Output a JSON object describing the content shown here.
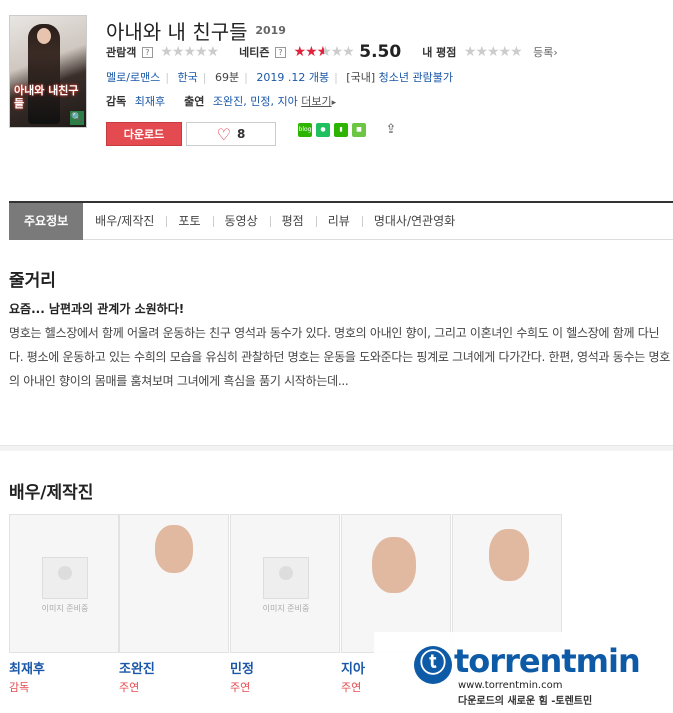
{
  "movie": {
    "title": "아내와 내 친구들",
    "year": "2019",
    "poster_title": "아내와 내친구들"
  },
  "ratings": {
    "audience_label": "관람객",
    "audience_stars": "★★★★★",
    "netizen_label": "네티즌",
    "netizen_score": "5.50",
    "netizen_stars_on": 2.5,
    "my_label": "내 평점",
    "register_label": "등록›"
  },
  "meta": {
    "genre": "멜로/로맨스",
    "country": "한국",
    "runtime": "69분",
    "release": "2019 .12 개봉",
    "rating_prefix": "[국내]",
    "rating": "청소년 관람불가"
  },
  "people": {
    "director_label": "감독",
    "director": "최재후",
    "cast_label": "출연",
    "cast": "조완진, 민정, 지아",
    "more": "더보기"
  },
  "actions": {
    "download": "다운로드",
    "like_count": "8"
  },
  "tabs": [
    "주요정보",
    "배우/제작진",
    "포토",
    "동영상",
    "평점",
    "리뷰",
    "명대사/연관영화"
  ],
  "plot": {
    "section_title": "줄거리",
    "headline": "요즘... 남편과의 관계가 소원하다!",
    "body": "명호는 헬스장에서 함께 어울려 운동하는 친구 영석과 동수가 있다. 명호의 아내인 향이, 그리고 이혼녀인 수희도 이 헬스장에 함께 다닌다. 평소에 운동하고 있는 수희의 모습을 유심히 관찰하던 명호는 운동을 도와준다는 핑계로 그녀에게 다가간다. 한편, 영석과 동수는 명호의 아내인 향이의 몸매를 훔쳐보며 그녀에게 흑심을 품기 시작하는데..."
  },
  "cast_section": {
    "title": "배우/제작진",
    "noimage_text": "이미지 준비중",
    "members": [
      {
        "name": "최재후",
        "role": "감독"
      },
      {
        "name": "조완진",
        "role": "주연"
      },
      {
        "name": "민정",
        "role": "주연"
      },
      {
        "name": "지아",
        "role": "주연"
      },
      {
        "name": "",
        "role": ""
      }
    ]
  },
  "watermark": {
    "brand": "torrentmin",
    "url": "www.torrentmin.com",
    "tagline": "다운로드의 새로운 힘 -토렌트민"
  },
  "colors": {
    "accent_red": "#e44b50",
    "link_blue": "#1a57a8",
    "star_red": "#e0233d"
  }
}
